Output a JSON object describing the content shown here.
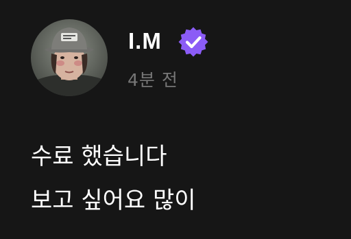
{
  "profile": {
    "username": "I.M",
    "verified": true,
    "verified_icon": "verified-badge-icon",
    "avatar_icon": "profile-avatar-photo"
  },
  "post": {
    "timestamp": "4분 전",
    "lines": [
      "수료 했습니다",
      "보고 싶어요 많이"
    ]
  },
  "colors": {
    "background": "#161616",
    "text": "#ffffff",
    "muted": "#777777",
    "verified_badge": "#8b5cf6"
  }
}
